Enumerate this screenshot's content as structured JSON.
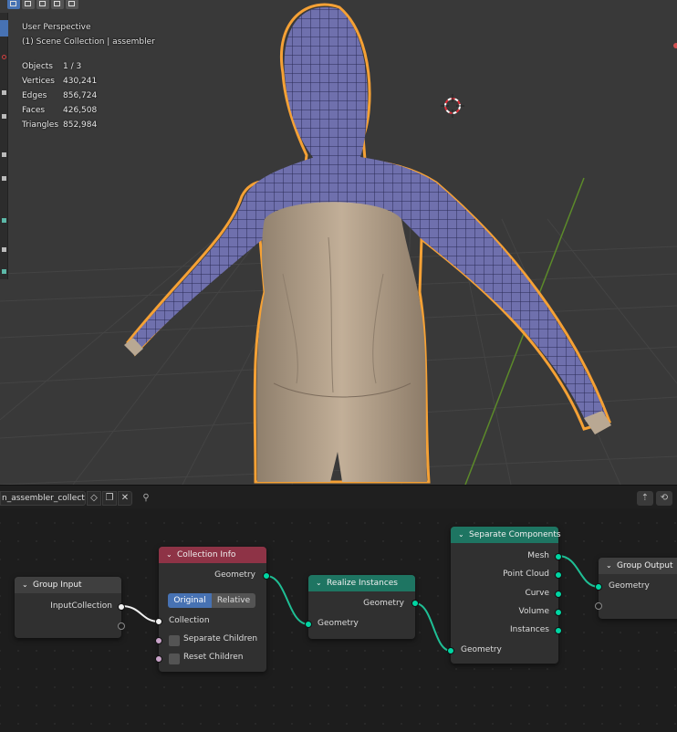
{
  "viewport": {
    "perspective_label": "User Perspective",
    "collection_label": "(1) Scene Collection | assembler",
    "stats": [
      {
        "label": "Objects",
        "value": "1 / 3"
      },
      {
        "label": "Vertices",
        "value": "430,241"
      },
      {
        "label": "Edges",
        "value": "856,724"
      },
      {
        "label": "Faces",
        "value": "426,508"
      },
      {
        "label": "Triangles",
        "value": "852,984"
      }
    ]
  },
  "node_editor": {
    "tree_name": "n_assembler_collection",
    "nodes": {
      "group_input": {
        "title": "Group Input",
        "outputs": [
          "InputCollection"
        ]
      },
      "collection_info": {
        "title": "Collection Info",
        "output": "Geometry",
        "mode_options": [
          "Original",
          "Relative"
        ],
        "mode_selected": "Original",
        "inputs": [
          "Collection",
          "Separate Children",
          "Reset Children"
        ]
      },
      "realize_instances": {
        "title": "Realize Instances",
        "output": "Geometry",
        "input": "Geometry"
      },
      "separate_components": {
        "title": "Separate Components",
        "outputs": [
          "Mesh",
          "Point Cloud",
          "Curve",
          "Volume",
          "Instances"
        ],
        "input": "Geometry"
      },
      "group_output": {
        "title": "Group Output",
        "inputs": [
          "Geometry"
        ]
      }
    }
  },
  "colors": {
    "viewport_bg": "#393939",
    "node_editor_bg": "#1d1d1d",
    "geometry_socket": "#00d6a3",
    "collection_header": "#8e3346",
    "geometry_node_header": "#1e7562",
    "selection_outline": "#f5a135",
    "mesh_wireframe": "#6a6aa8",
    "active_button": "#4772b3"
  }
}
